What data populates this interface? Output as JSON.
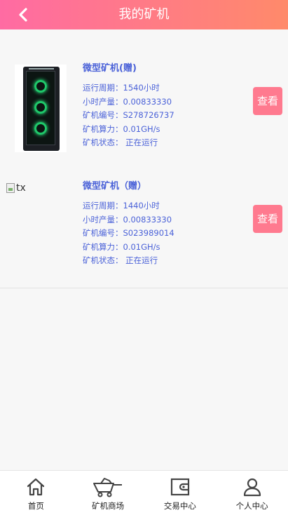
{
  "header": {
    "title": "我的矿机"
  },
  "miners": [
    {
      "image_alt": "",
      "name": "微型矿机(赠)",
      "cycle": "运行周期：1540小时",
      "hourly_output": "小时产量：0.00833330",
      "serial": "矿机编号：S278726737",
      "hashrate": "矿机算力：0.01GH/s",
      "status": "矿机状态： 正在运行",
      "view_label": "查看"
    },
    {
      "image_alt": "tx",
      "name": "微型矿机（赠）",
      "cycle": "运行周期：1440小时",
      "hourly_output": "小时产量：0.00833330",
      "serial": "矿机编号：S023989014",
      "hashrate": "矿机算力：0.01GH/s",
      "status": "矿机状态： 正在运行",
      "view_label": "查看"
    }
  ],
  "tabbar": {
    "home": "首页",
    "market": "矿机商场",
    "trade": "交易中心",
    "profile": "个人中心"
  },
  "colors": {
    "header_gradient_start": "#ff6ba3",
    "header_gradient_end": "#ff8a6a",
    "info_text": "#4b62d8",
    "view_button": "#ff7a8f"
  }
}
